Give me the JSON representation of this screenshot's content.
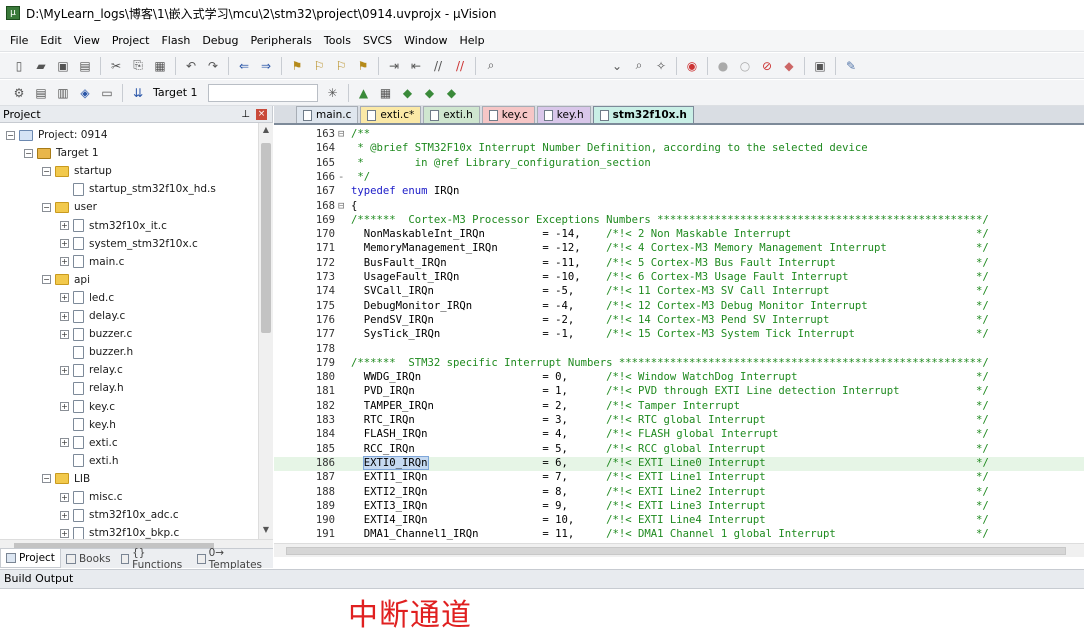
{
  "window": {
    "title": "D:\\MyLearn_logs\\博客\\1\\嵌入式学习\\mcu\\2\\stm32\\project\\0914.uvprojx - µVision"
  },
  "menu": [
    "File",
    "Edit",
    "View",
    "Project",
    "Flash",
    "Debug",
    "Peripherals",
    "Tools",
    "SVCS",
    "Window",
    "Help"
  ],
  "toolbar": {
    "target": "Target 1"
  },
  "project_panel": {
    "title": "Project",
    "tree": [
      {
        "label": "Project: 0914",
        "depth": 0,
        "kind": "proj",
        "exp": "-"
      },
      {
        "label": "Target 1",
        "depth": 1,
        "kind": "tgt",
        "exp": "-"
      },
      {
        "label": "startup",
        "depth": 2,
        "kind": "folder",
        "exp": "-"
      },
      {
        "label": "startup_stm32f10x_hd.s",
        "depth": 3,
        "kind": "file",
        "exp": ""
      },
      {
        "label": "user",
        "depth": 2,
        "kind": "folder",
        "exp": "-"
      },
      {
        "label": "stm32f10x_it.c",
        "depth": 3,
        "kind": "file",
        "exp": "+"
      },
      {
        "label": "system_stm32f10x.c",
        "depth": 3,
        "kind": "file",
        "exp": "+"
      },
      {
        "label": "main.c",
        "depth": 3,
        "kind": "file",
        "exp": "+"
      },
      {
        "label": "api",
        "depth": 2,
        "kind": "folder",
        "exp": "-"
      },
      {
        "label": "led.c",
        "depth": 3,
        "kind": "file",
        "exp": "+"
      },
      {
        "label": "delay.c",
        "depth": 3,
        "kind": "file",
        "exp": "+"
      },
      {
        "label": "buzzer.c",
        "depth": 3,
        "kind": "file",
        "exp": "+"
      },
      {
        "label": "buzzer.h",
        "depth": 3,
        "kind": "file",
        "exp": ""
      },
      {
        "label": "relay.c",
        "depth": 3,
        "kind": "file",
        "exp": "+"
      },
      {
        "label": "relay.h",
        "depth": 3,
        "kind": "file",
        "exp": ""
      },
      {
        "label": "key.c",
        "depth": 3,
        "kind": "file",
        "exp": "+"
      },
      {
        "label": "key.h",
        "depth": 3,
        "kind": "file",
        "exp": ""
      },
      {
        "label": "exti.c",
        "depth": 3,
        "kind": "file",
        "exp": "+"
      },
      {
        "label": "exti.h",
        "depth": 3,
        "kind": "file",
        "exp": ""
      },
      {
        "label": "LIB",
        "depth": 2,
        "kind": "folder",
        "exp": "-"
      },
      {
        "label": "misc.c",
        "depth": 3,
        "kind": "file",
        "exp": "+"
      },
      {
        "label": "stm32f10x_adc.c",
        "depth": 3,
        "kind": "file",
        "exp": "+"
      },
      {
        "label": "stm32f10x_bkp.c",
        "depth": 3,
        "kind": "file",
        "exp": "+"
      }
    ],
    "tabs": [
      "Project",
      "Books",
      "{} Functions",
      "0→ Templates"
    ]
  },
  "editor": {
    "tabs": [
      {
        "label": "main.c",
        "color": "#dfe6ee"
      },
      {
        "label": "exti.c*",
        "color": "#fbe9a7"
      },
      {
        "label": "exti.h",
        "color": "#cfe6cf"
      },
      {
        "label": "key.c",
        "color": "#f6c6c6"
      },
      {
        "label": "key.h",
        "color": "#d9c7ea"
      },
      {
        "label": "stm32f10x.h",
        "color": "#c9efe6",
        "active": true
      }
    ],
    "lines": [
      {
        "n": "163",
        "g": "⊟",
        "t": "/**",
        "c": "cm"
      },
      {
        "n": "164",
        "g": "",
        "t": " * @brief STM32F10x Interrupt Number Definition, according to the selected device",
        "c": "cm"
      },
      {
        "n": "165",
        "g": "",
        "t": " *        in @ref Library_configuration_section",
        "c": "cm"
      },
      {
        "n": "166",
        "g": "-",
        "t": " */",
        "c": "cm"
      },
      {
        "n": "167",
        "g": "",
        "t": "typedef enum IRQn",
        "c": "kw"
      },
      {
        "n": "168",
        "g": "⊟",
        "t": "{",
        "c": ""
      },
      {
        "n": "169",
        "g": "",
        "t": "/******  Cortex-M3 Processor Exceptions Numbers ***************************************************/",
        "c": "cm"
      },
      {
        "n": "170",
        "g": "",
        "t": "  NonMaskableInt_IRQn         = -14,    /*!< 2 Non Maskable Interrupt                             */",
        "c": ""
      },
      {
        "n": "171",
        "g": "",
        "t": "  MemoryManagement_IRQn       = -12,    /*!< 4 Cortex-M3 Memory Management Interrupt              */",
        "c": ""
      },
      {
        "n": "172",
        "g": "",
        "t": "  BusFault_IRQn               = -11,    /*!< 5 Cortex-M3 Bus Fault Interrupt                      */",
        "c": ""
      },
      {
        "n": "173",
        "g": "",
        "t": "  UsageFault_IRQn             = -10,    /*!< 6 Cortex-M3 Usage Fault Interrupt                    */",
        "c": ""
      },
      {
        "n": "174",
        "g": "",
        "t": "  SVCall_IRQn                 = -5,     /*!< 11 Cortex-M3 SV Call Interrupt                       */",
        "c": ""
      },
      {
        "n": "175",
        "g": "",
        "t": "  DebugMonitor_IRQn           = -4,     /*!< 12 Cortex-M3 Debug Monitor Interrupt                 */",
        "c": ""
      },
      {
        "n": "176",
        "g": "",
        "t": "  PendSV_IRQn                 = -2,     /*!< 14 Cortex-M3 Pend SV Interrupt                       */",
        "c": ""
      },
      {
        "n": "177",
        "g": "",
        "t": "  SysTick_IRQn                = -1,     /*!< 15 Cortex-M3 System Tick Interrupt                   */",
        "c": ""
      },
      {
        "n": "178",
        "g": "",
        "t": "",
        "c": ""
      },
      {
        "n": "179",
        "g": "",
        "t": "/******  STM32 specific Interrupt Numbers *********************************************************/",
        "c": "cm"
      },
      {
        "n": "180",
        "g": "",
        "t": "  WWDG_IRQn                   = 0,      /*!< Window WatchDog Interrupt                            */",
        "c": ""
      },
      {
        "n": "181",
        "g": "",
        "t": "  PVD_IRQn                    = 1,      /*!< PVD through EXTI Line detection Interrupt            */",
        "c": ""
      },
      {
        "n": "182",
        "g": "",
        "t": "  TAMPER_IRQn                 = 2,      /*!< Tamper Interrupt                                     */",
        "c": ""
      },
      {
        "n": "183",
        "g": "",
        "t": "  RTC_IRQn                    = 3,      /*!< RTC global Interrupt                                 */",
        "c": ""
      },
      {
        "n": "184",
        "g": "",
        "t": "  FLASH_IRQn                  = 4,      /*!< FLASH global Interrupt                               */",
        "c": ""
      },
      {
        "n": "185",
        "g": "",
        "t": "  RCC_IRQn                    = 5,      /*!< RCC global Interrupt                                 */",
        "c": ""
      },
      {
        "n": "186",
        "g": "",
        "t": "  EXTI0_IRQn                  = 6,      /*!< EXTI Line0 Interrupt                                 */",
        "c": "hl"
      },
      {
        "n": "187",
        "g": "",
        "t": "  EXTI1_IRQn                  = 7,      /*!< EXTI Line1 Interrupt                                 */",
        "c": ""
      },
      {
        "n": "188",
        "g": "",
        "t": "  EXTI2_IRQn                  = 8,      /*!< EXTI Line2 Interrupt                                 */",
        "c": ""
      },
      {
        "n": "189",
        "g": "",
        "t": "  EXTI3_IRQn                  = 9,      /*!< EXTI Line3 Interrupt                                 */",
        "c": ""
      },
      {
        "n": "190",
        "g": "",
        "t": "  EXTI4_IRQn                  = 10,     /*!< EXTI Line4 Interrupt                                 */",
        "c": ""
      },
      {
        "n": "191",
        "g": "",
        "t": "  DMA1_Channel1_IRQn          = 11,     /*!< DMA1 Channel 1 global Interrupt                      */",
        "c": ""
      }
    ]
  },
  "build_output": {
    "title": "Build Output"
  },
  "caption": "中断通道"
}
